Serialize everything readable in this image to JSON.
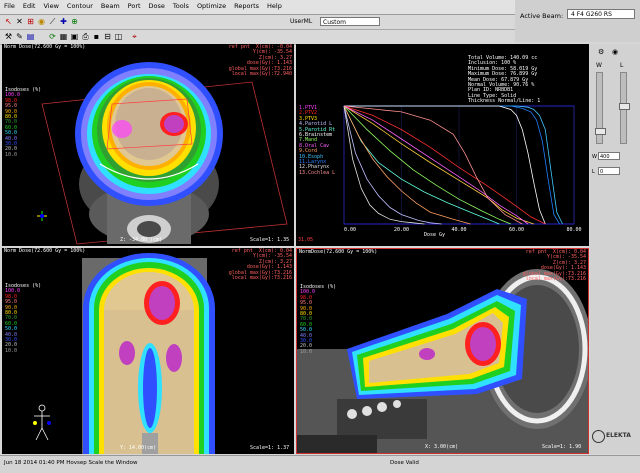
{
  "menu": {
    "items": [
      "File",
      "Edit",
      "View",
      "Contour",
      "Beam",
      "Port",
      "Dose",
      "Tools",
      "Optimize",
      "Reports",
      "Help"
    ]
  },
  "toolbar": {
    "userml_label": "UserML",
    "userml_value": "Custom",
    "active_beam_label": "Active Beam:",
    "active_beam_value": "4 F4 G260 RS"
  },
  "views": {
    "axial": {
      "header": "Norm Dose(72.600 Gy = 100%)",
      "ref_lines": [
        "ref pnt  X(cm): -0.04",
        "Y(cm): -35.54",
        "Z(cm): 3.27",
        "dose(Gy): 1.143",
        "global max(Gy):73.216",
        "local max(Gy):72.940"
      ],
      "isodose_title": "Isodoses (%)",
      "isodose_levels": [
        "100.0",
        "98.0",
        "95.0",
        "90.0",
        "80.0",
        "70.0",
        "60.0",
        "50.0",
        "40.0",
        "30.0",
        "20.0",
        "10.0"
      ],
      "slice_label": "Z: -34.00 (cm)",
      "scale_label": "Scale=1: 1.35"
    },
    "coronal": {
      "header": "Norm Dose(72.600 Gy = 100%)",
      "ref_lines": [
        "ref pnt  X(cm): 0.04",
        "Y(cm): -35.54",
        "Z(cm): 3.27",
        "dose(Gy): 1.143",
        "global max(Gy):73.216",
        "local max(Gy):73.216"
      ],
      "isodose_title": "Isodoses (%)",
      "isodose_levels": [
        "100.0",
        "98.0",
        "95.0",
        "90.0",
        "80.0",
        "70.0",
        "60.0",
        "50.0",
        "40.0",
        "30.0",
        "20.0",
        "10.0"
      ],
      "slice_label": "Y: 14.00(cm)",
      "scale_label": "Scale=1: 1.37"
    },
    "sagittal": {
      "header": "NormDose(72.600 Gy = 100%)",
      "ref_lines": [
        "ref pnt  X(cm): 0.04",
        "Y(cm): -35.54",
        "Z(cm): 3.27",
        "dose(Gy): 1.143",
        "global max(Gy):73.216",
        "local max(Gy):73.216"
      ],
      "isodose_title": "Isodoses (%)",
      "isodose_levels": [
        "100.0",
        "98.0",
        "95.0",
        "90.0",
        "80.0",
        "70.0",
        "60.0",
        "50.0",
        "40.0",
        "30.0",
        "20.0",
        "10.0"
      ],
      "slice_label": "X: 3.00(cm)",
      "scale_label": "Scale=1: 1.90"
    }
  },
  "dvh": {
    "stats_lines": [
      "Total Volume: 140.09 cc",
      "Inclusion: 100 %",
      "Minimum Dose: 58.019 Gy",
      "Maximum Dose: 76.899 Gy",
      "Mean Dose: 67.879 Gy",
      "Normal Volume: 90.76 %",
      "Plan ID: NRBDB1",
      "Line Type: Solid",
      "Thickness Normal/Line: 1"
    ],
    "legend": [
      "1.PTV1",
      "2.PTV2",
      "3.PTV3",
      "4.Parotid L",
      "5.Parotid Rt",
      "6.Brainstem",
      "7.Mand",
      "8.Oral Cav",
      "9.Cord",
      "10.Esoph",
      "11.Larynx",
      "12.Pharynx",
      "13.Cochlea L"
    ],
    "xlabel": "Dose Gy",
    "corner_value": "31.05",
    "chart_data": {
      "type": "line",
      "xlabel": "Dose Gy",
      "xlim": [
        0,
        80
      ],
      "ylim": [
        0,
        100
      ],
      "xticks": [
        "0.00",
        "20.00",
        "40.00",
        "60.00",
        "80.00"
      ],
      "series": [
        {
          "color": "#40c8ff",
          "x": [
            0,
            60,
            64,
            66,
            68,
            70,
            72,
            74,
            76
          ],
          "y": [
            100,
            100,
            99,
            97,
            92,
            80,
            45,
            10,
            0
          ]
        },
        {
          "color": "#2080ff",
          "x": [
            0,
            58,
            62,
            65,
            67,
            69,
            71,
            73,
            75
          ],
          "y": [
            100,
            100,
            98,
            95,
            88,
            70,
            38,
            8,
            0
          ]
        },
        {
          "color": "#ffffff",
          "x": [
            0,
            54,
            58,
            60,
            62,
            64,
            66,
            68,
            70
          ],
          "y": [
            100,
            100,
            97,
            92,
            80,
            60,
            35,
            12,
            0
          ]
        },
        {
          "color": "#ff3030",
          "x": [
            0,
            10,
            20,
            30,
            40,
            50,
            60,
            65,
            70
          ],
          "y": [
            100,
            92,
            80,
            65,
            48,
            32,
            15,
            6,
            0
          ]
        },
        {
          "color": "#ffd040",
          "x": [
            0,
            10,
            20,
            30,
            40,
            50,
            55,
            60,
            66
          ],
          "y": [
            100,
            85,
            68,
            52,
            37,
            22,
            12,
            5,
            0
          ]
        },
        {
          "color": "#90ff60",
          "x": [
            0,
            8,
            16,
            24,
            32,
            40,
            48,
            54,
            58
          ],
          "y": [
            100,
            80,
            62,
            46,
            33,
            21,
            11,
            4,
            0
          ]
        },
        {
          "color": "#ff60ff",
          "x": [
            0,
            10,
            20,
            30,
            40,
            48,
            54,
            60,
            64
          ],
          "y": [
            100,
            88,
            72,
            56,
            40,
            27,
            16,
            7,
            0
          ]
        },
        {
          "color": "#60ffe0",
          "x": [
            0,
            6,
            12,
            20,
            28,
            36,
            44,
            50,
            54
          ],
          "y": [
            100,
            70,
            52,
            38,
            27,
            18,
            10,
            4,
            0
          ]
        },
        {
          "color": "#c0c0ff",
          "x": [
            0,
            4,
            8,
            12,
            16,
            20,
            26,
            30,
            34
          ],
          "y": [
            100,
            60,
            38,
            24,
            14,
            8,
            3,
            1,
            0
          ]
        },
        {
          "color": "#ffa060",
          "x": [
            0,
            5,
            10,
            15,
            20,
            25,
            30,
            38,
            44
          ],
          "y": [
            100,
            75,
            55,
            40,
            28,
            18,
            10,
            4,
            0
          ]
        },
        {
          "color": "#e0e0e0",
          "x": [
            0,
            3,
            6,
            9,
            12,
            16,
            20,
            24,
            28
          ],
          "y": [
            100,
            55,
            30,
            16,
            9,
            4,
            2,
            1,
            0
          ]
        },
        {
          "color": "#ff9090",
          "x": [
            0,
            20,
            30,
            38,
            42,
            46,
            50,
            56,
            62
          ],
          "y": [
            100,
            95,
            88,
            76,
            60,
            40,
            22,
            8,
            0
          ]
        }
      ]
    }
  },
  "status": {
    "left": "Jun 18 2014 01:40 PM  Hovsep  Scale the Window",
    "center": "Dose Valid",
    "logo": "ELEKTA"
  },
  "right_panel": {
    "w_label": "W",
    "l_label": "L",
    "w_value": "400",
    "l_value": "0"
  },
  "colors": {
    "ptv_magenta": "#ff40ff",
    "isodose_red": "#ff2020",
    "isodose_yellow": "#ffe000",
    "isodose_green": "#20d020",
    "isodose_cyan": "#30e0ff",
    "isodose_blue": "#3050ff"
  }
}
